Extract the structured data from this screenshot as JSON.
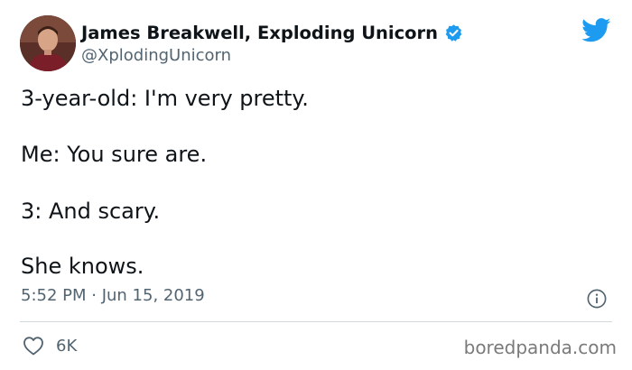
{
  "tweet": {
    "author": {
      "display_name": "James Breakwell, Exploding Unicorn",
      "handle": "@XplodingUnicorn",
      "verified": true,
      "avatar_icon": "avatar-photo"
    },
    "body_lines": [
      "3-year-old: I'm very pretty.",
      "Me: You sure are.",
      "3: And scary.",
      "She knows."
    ],
    "timestamp": "5:52 PM · Jun 15, 2019",
    "likes": "6K",
    "icons": {
      "verified": "verified-badge-icon",
      "platform": "twitter-bird-icon",
      "info": "info-icon",
      "like": "heart-icon"
    }
  },
  "watermark": "boredpanda.com",
  "colors": {
    "brand_blue": "#1d9bf0",
    "text_primary": "#0f1419",
    "text_secondary": "#536471",
    "divider": "#cfd9de",
    "watermark": "#7a7a7a"
  }
}
